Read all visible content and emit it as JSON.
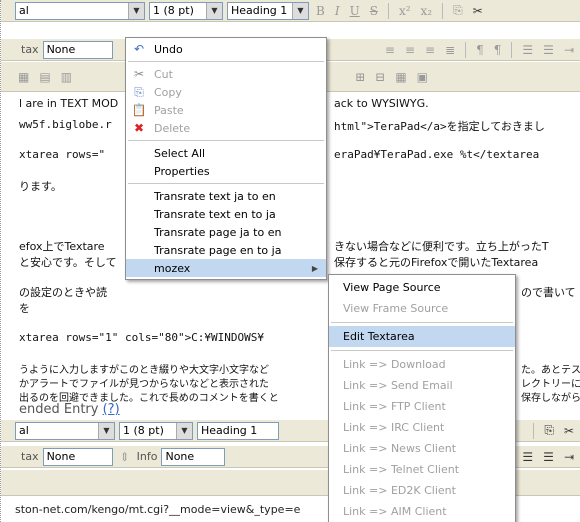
{
  "toolbar1": {
    "font_value": "al",
    "size_value": "1 (8 pt)",
    "format_value": "Heading 1",
    "glyphs": [
      "B",
      "I",
      "U",
      "S",
      "x²",
      "x₂",
      "⎘",
      "✂"
    ]
  },
  "toolbar2": {
    "syntax_label": "tax",
    "syntax_value": "None"
  },
  "editor_lines": [
    "l are in TEXT MOD",
    "ww5f.biglobe.r",
    "xtarea rows=\"",
    "ります。",
    "efox上でTextare",
    "と安心です。そして",
    "の設定のときや読",
    "を",
    "xtarea rows=\"1\" cols=\"80\">C:¥WINDOWS¥",
    "うように入力しますがこのとき綴りや大文字小文字など",
    "かアラートでファイルが見つからないなどと表示された",
    "出るのを回避できました。これで長めのコメントを書くと"
  ],
  "editor_right_fragments": [
    "ack to WYSIWYG.",
    "html\">TeraPad</a>を指定しておきまし",
    "eraPad¥TeraPad.exe %t</textarea",
    "きない場合などに便利です。立ち上がったT",
    "保存すると元のFirefoxで開いたTextarea",
    "ので書いて",
    "た。あとテス",
    "レクトリーに",
    "保存しながら"
  ],
  "extended_entry": {
    "label": "ended Entry",
    "help": "(?)"
  },
  "toolbar3": {
    "font_value": "al",
    "size_value": "1 (8 pt)",
    "format_value": "Heading 1"
  },
  "toolbar4": {
    "syntax_label": "tax",
    "syntax_value": "None",
    "info_label": "Info",
    "info_value": "None"
  },
  "status_url": "ston-net.com/kengo/mt.cgi?__mode=view&_type=e",
  "context_menu": {
    "items": [
      {
        "label": "Undo",
        "icon": "undo-icon",
        "disabled": false
      },
      {
        "label": "Cut",
        "icon": "scissors-icon",
        "disabled": true
      },
      {
        "label": "Copy",
        "icon": "copy-icon",
        "disabled": true
      },
      {
        "label": "Paste",
        "icon": "paste-icon",
        "disabled": true
      },
      {
        "label": "Delete",
        "icon": "delete-icon",
        "disabled": true
      },
      {
        "label": "Select All",
        "disabled": false
      },
      {
        "label": "Properties",
        "disabled": false
      },
      {
        "label": "Transrate text ja to en",
        "disabled": false
      },
      {
        "label": "Transrate text en to ja",
        "disabled": false
      },
      {
        "label": "Transrate page ja to en",
        "disabled": false
      },
      {
        "label": "Transrate page en to ja",
        "disabled": false
      },
      {
        "label": "mozex",
        "disabled": false
      }
    ]
  },
  "mozex_submenu": {
    "items": [
      {
        "label": "View Page Source",
        "disabled": false
      },
      {
        "label": "View Frame Source",
        "disabled": true
      },
      {
        "label": "Edit Textarea",
        "disabled": false
      },
      {
        "label": "Link => Download",
        "disabled": true
      },
      {
        "label": "Link => Send Email",
        "disabled": true
      },
      {
        "label": "Link => FTP Client",
        "disabled": true
      },
      {
        "label": "Link => IRC Client",
        "disabled": true
      },
      {
        "label": "Link => News Client",
        "disabled": true
      },
      {
        "label": "Link => Telnet Client",
        "disabled": true
      },
      {
        "label": "Link => ED2K Client",
        "disabled": true
      },
      {
        "label": "Link => AIM Client",
        "disabled": true
      }
    ]
  },
  "colors": {
    "menu_highlight": "#c2d8f0",
    "toolbar_bg": "#ece9d8",
    "link": "#3366cc"
  }
}
